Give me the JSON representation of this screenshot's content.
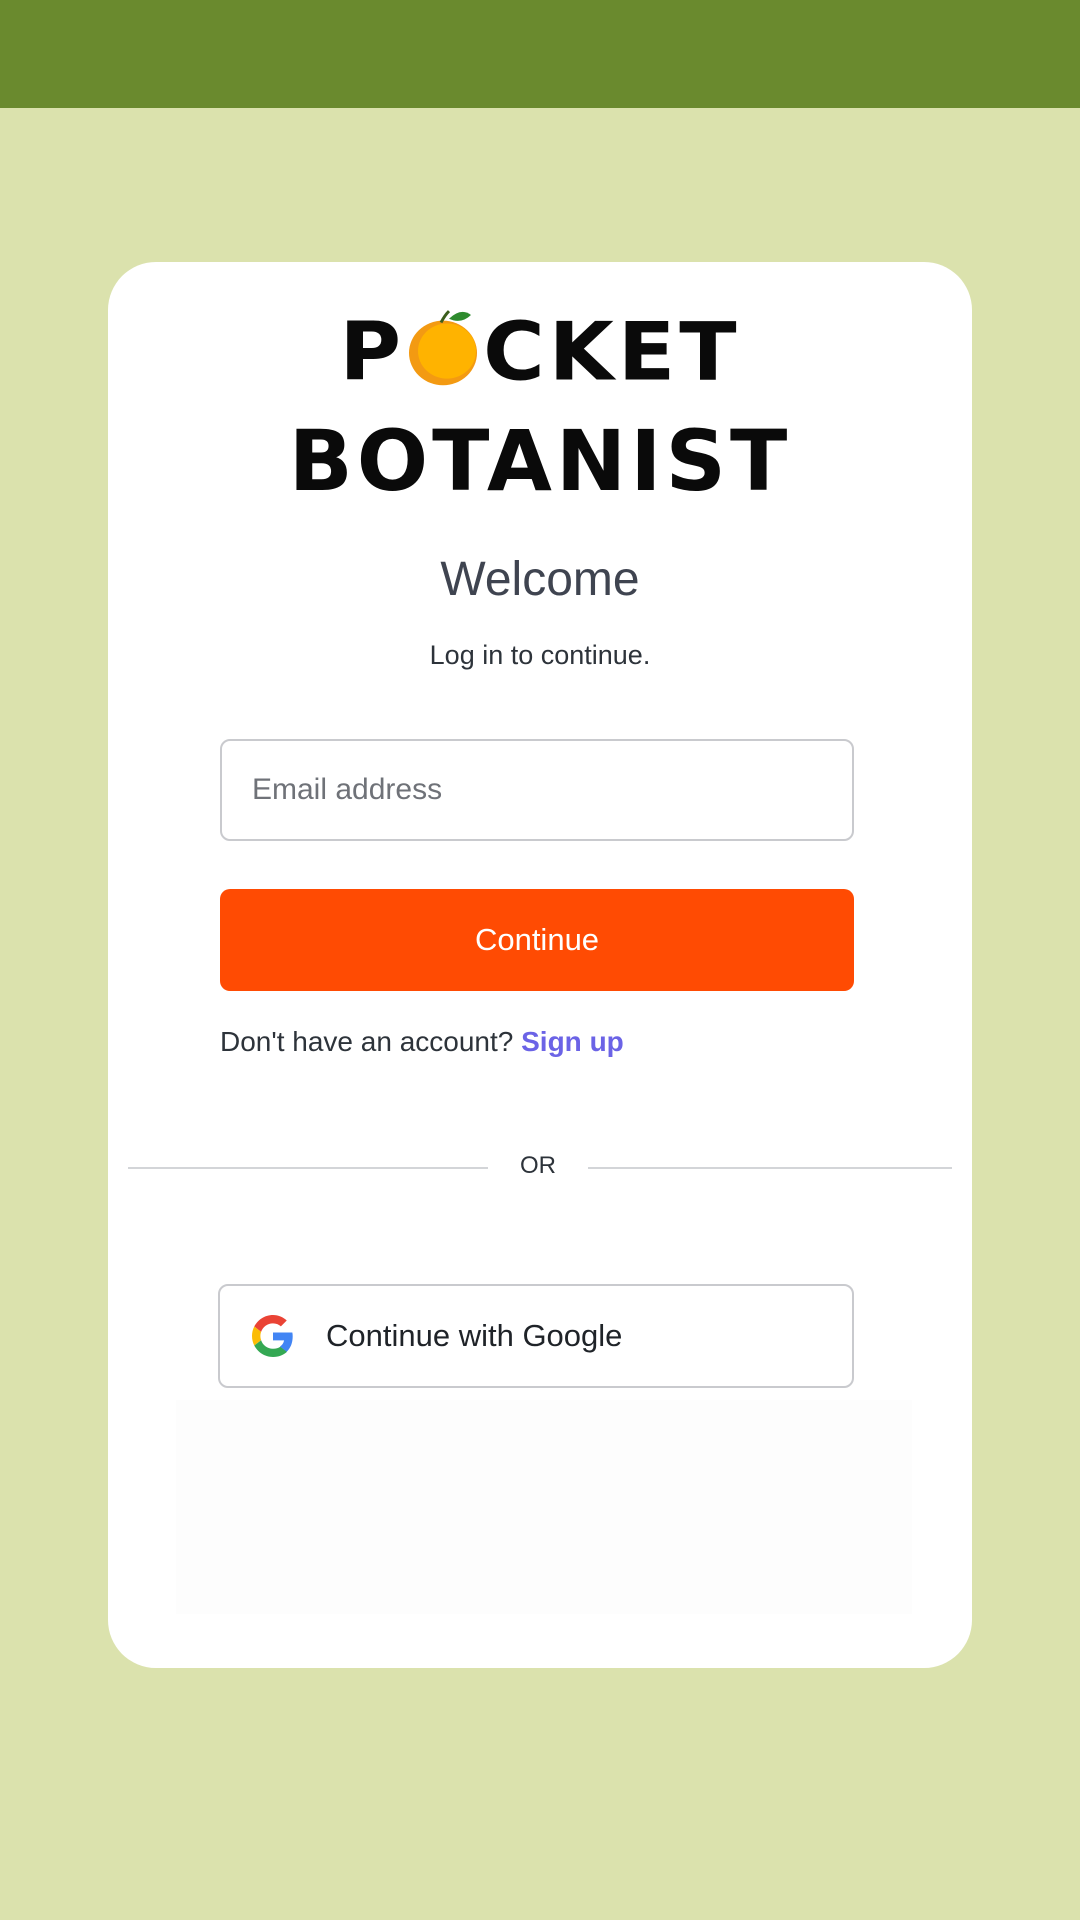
{
  "logo": {
    "line1_before": "P",
    "line1_after": "CKET",
    "line2": "BOTANIST",
    "icon": "orange-fruit-icon"
  },
  "login": {
    "title": "Welcome",
    "subtitle": "Log in to continue.",
    "email_placeholder": "Email address",
    "email_value": "",
    "continue_label": "Continue",
    "no_account_text": "Don't have an account?",
    "signup_label": "Sign up",
    "divider_text": "OR",
    "google_label": "Continue with Google"
  },
  "colors": {
    "top_bar": "#6a8a2e",
    "background": "#dbe2ad",
    "primary_button": "#ff4b03",
    "link": "#6b63e6"
  }
}
